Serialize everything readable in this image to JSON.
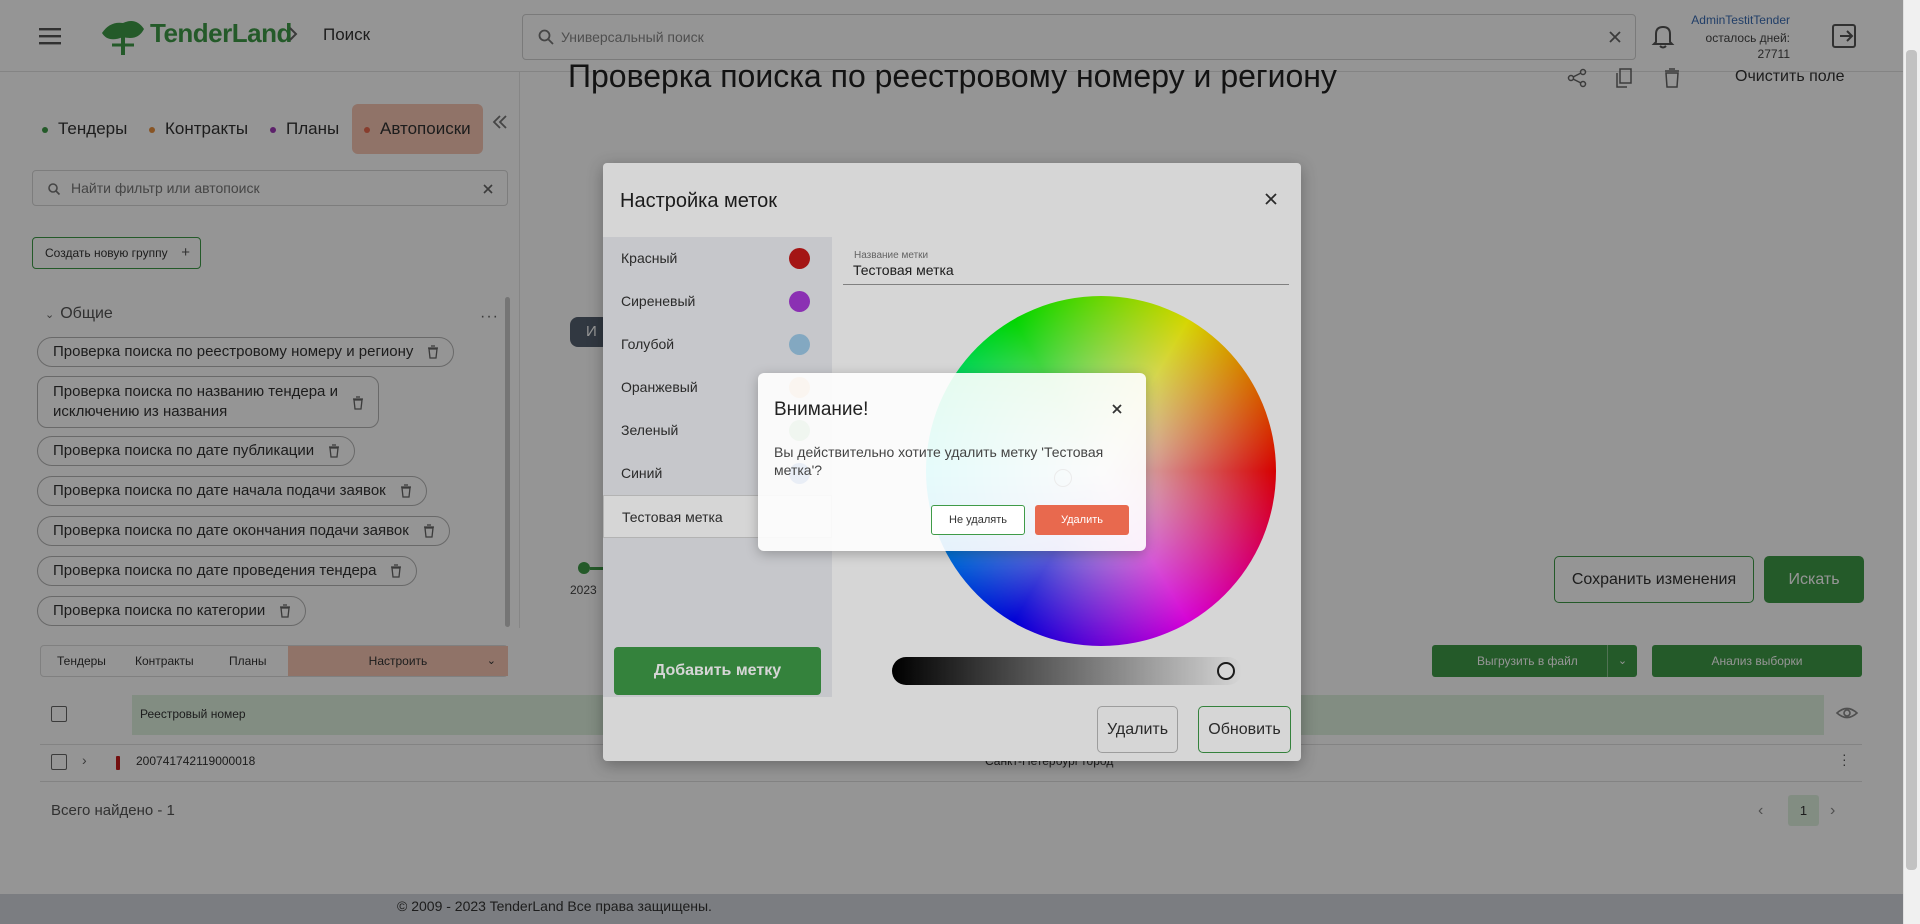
{
  "header": {
    "logo_text": "TenderLand",
    "breadcrumb": "Поиск",
    "search_placeholder": "Универсальный поиск",
    "user_name": "AdminTestitTender",
    "days_label": "осталось дней:",
    "days_value": "27711"
  },
  "sidebar": {
    "tabs": [
      {
        "label": "Тендеры",
        "color": "#3f9b48"
      },
      {
        "label": "Контракты",
        "color": "#e89140"
      },
      {
        "label": "Планы",
        "color": "#a03ab8"
      },
      {
        "label": "Автопоиски",
        "color": "#e8694e"
      }
    ],
    "filter_placeholder": "Найти фильтр или автопоиск",
    "create_group_label": "Создать новую группу",
    "group_title": "Общие",
    "items": [
      "Проверка поиска по реестровому номеру и региону",
      "Проверка поиска по названию тендера и",
      "исключению из названия",
      "Проверка поиска по дате публикации",
      "Проверка поиска по дате начала подачи заявок",
      "Проверка поиска по дате окончания подачи заявок",
      "Проверка поиска по дате проведения тендера",
      "Проверка поиска по категории"
    ]
  },
  "main": {
    "title": "Проверка поиска по реестровому номеру и региону",
    "clear_label": "Очистить поле",
    "chip_label": "И",
    "year_label": "2023",
    "save_label": "Сохранить изменения",
    "search_label": "Искать"
  },
  "results": {
    "tabs": [
      "Тендеры",
      "Контракты",
      "Планы",
      "Настроить"
    ],
    "export_label": "Выгрузить в файл",
    "analysis_label": "Анализ выборки",
    "column_header": "Реестровый номер",
    "row": {
      "number": "200741742119000018",
      "region": "Санкт-Петербург город"
    },
    "total": "Всего найдено - 1",
    "page": "1"
  },
  "footer": "© 2009 - 2023 TenderLand Все права защищены.",
  "label_modal": {
    "title": "Настройка меток",
    "colors": [
      {
        "label": "Красный",
        "color": "#c41a1a"
      },
      {
        "label": "Сиреневый",
        "color": "#a63ad6"
      },
      {
        "label": "Голубой",
        "color": "#9cc9e6"
      },
      {
        "label": "Оранжевый",
        "color": "#f2b47a"
      },
      {
        "label": "Зеленый",
        "color": "#7fc27a"
      },
      {
        "label": "Синий",
        "color": "#2f5fc4"
      },
      {
        "label": "Тестовая метка",
        "color": ""
      }
    ],
    "name_caption": "Название метки",
    "name_value": "Тестовая метка",
    "add_label": "Добавить метку",
    "delete_label": "Удалить",
    "update_label": "Обновить"
  },
  "confirm": {
    "title": "Внимание!",
    "text": "Вы действительно хотите удалить метку 'Тестовая метка'?",
    "cancel_label": "Не удалять",
    "confirm_label": "Удалить"
  }
}
